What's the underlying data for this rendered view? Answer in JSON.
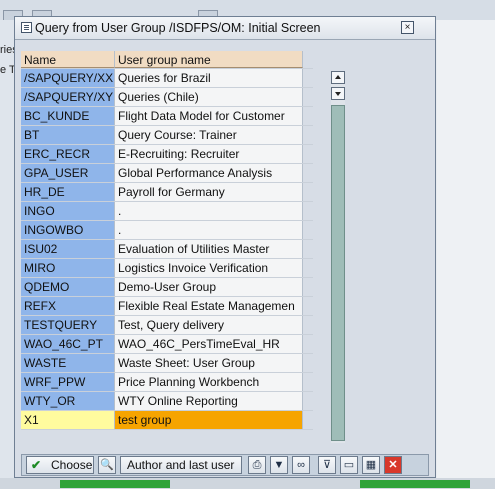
{
  "background": {
    "left_fragment_1": "ries",
    "left_fragment_2": "e T"
  },
  "dialog": {
    "title": "Query from User Group /ISDFPS/OM: Initial Screen",
    "close_glyph": "×"
  },
  "table": {
    "columns": [
      "Name",
      "User group name"
    ],
    "rows": [
      [
        "/SAPQUERY/XX",
        "Queries for Brazil"
      ],
      [
        "/SAPQUERY/XY",
        "Queries (Chile)"
      ],
      [
        "BC_KUNDE",
        "Flight Data Model for Customer"
      ],
      [
        "BT",
        "Query Course: Trainer"
      ],
      [
        "ERC_RECR",
        "E-Recruiting: Recruiter"
      ],
      [
        "GPA_USER",
        "Global Performance Analysis"
      ],
      [
        "HR_DE",
        "Payroll for Germany"
      ],
      [
        "INGO",
        "."
      ],
      [
        "INGOWBO",
        "."
      ],
      [
        "ISU02",
        "Evaluation of Utilities Master"
      ],
      [
        "MIRO",
        "Logistics Invoice Verification"
      ],
      [
        "QDEMO",
        "Demo-User Group"
      ],
      [
        "REFX",
        "Flexible Real Estate Managemen"
      ],
      [
        "TESTQUERY",
        "Test, Query delivery"
      ],
      [
        "WAO_46C_PT",
        "WAO_46C_PersTimeEval_HR"
      ],
      [
        "WASTE",
        "Waste Sheet: User Group"
      ],
      [
        "WRF_PPW",
        "Price Planning Workbench"
      ],
      [
        "WTY_OR",
        "WTY Online Reporting"
      ],
      [
        "X1",
        "test group"
      ]
    ],
    "selected_row": 18
  },
  "toolbar": {
    "choose_label": "Choose",
    "author_label": "Author and last user",
    "icons": [
      "check-icon",
      "find-icon",
      "print-icon",
      "filter-icon",
      "binoculars-icon",
      "set-filter-icon",
      "document-icon",
      "table-grid-icon",
      "cancel-icon"
    ]
  },
  "colors": {
    "key_column": "#8fb5ea",
    "header": "#f1dcc3",
    "selected_key": "#fffb9e",
    "selected_text": "#f6a400",
    "cancel": "#d8382b"
  }
}
